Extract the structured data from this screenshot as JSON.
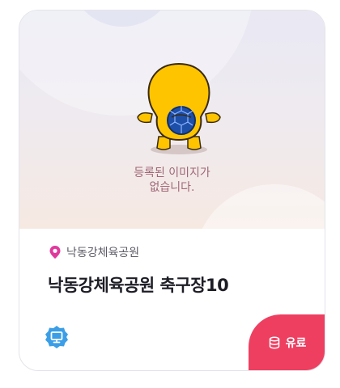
{
  "thumbnail": {
    "empty_line1": "등록된 이미지가",
    "empty_line2": "없습니다."
  },
  "location": {
    "name": "낙동강체육공원",
    "icon": "location-pin-icon"
  },
  "facility": {
    "title": "낙동강체육공원 축구장10"
  },
  "badges": {
    "type_icon": "monitor-icon",
    "paid_label": "유료",
    "paid_icon": "database-icon"
  },
  "colors": {
    "accent_pink": "#ee3f61",
    "pin_pink": "#e0399c",
    "badge_blue": "#3b9ee6",
    "mascot_yellow": "#ffc400",
    "ball_blue": "#1e4fa8"
  }
}
